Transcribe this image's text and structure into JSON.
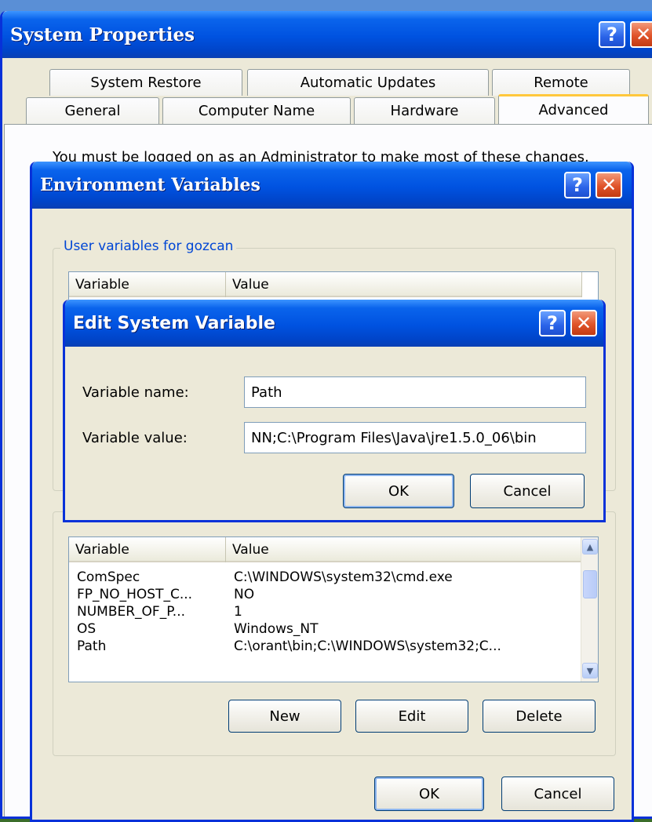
{
  "system_properties": {
    "title": "System Properties",
    "tabs_row1": [
      "System Restore",
      "Automatic Updates",
      "Remote"
    ],
    "tabs_row2": [
      "General",
      "Computer Name",
      "Hardware",
      "Advanced"
    ],
    "active_tab": "Advanced",
    "notice": "You must be logged on as an Administrator to make most of these changes."
  },
  "environment_variables": {
    "title": "Environment Variables",
    "user_group_label": "User variables for gozcan",
    "user_columns": [
      "Variable",
      "Value"
    ],
    "system_columns": [
      "Variable",
      "Value"
    ],
    "system_rows": [
      {
        "variable": "ComSpec",
        "value": "C:\\WINDOWS\\system32\\cmd.exe"
      },
      {
        "variable": "FP_NO_HOST_C...",
        "value": "NO"
      },
      {
        "variable": "NUMBER_OF_P...",
        "value": "1"
      },
      {
        "variable": "OS",
        "value": "Windows_NT"
      },
      {
        "variable": "Path",
        "value": "C:\\orant\\bin;C:\\WINDOWS\\system32;C..."
      }
    ],
    "buttons": {
      "new": "New",
      "edit": "Edit",
      "delete": "Delete",
      "ok": "OK",
      "cancel": "Cancel"
    }
  },
  "edit_system_variable": {
    "title": "Edit System Variable",
    "name_label": "Variable name:",
    "name_value": "Path",
    "value_label": "Variable value:",
    "value_value": "NN;C:\\Program Files\\Java\\jre1.5.0_06\\bin",
    "ok": "OK",
    "cancel": "Cancel"
  },
  "titlebar_buttons": {
    "help": "?",
    "close": "✕"
  }
}
